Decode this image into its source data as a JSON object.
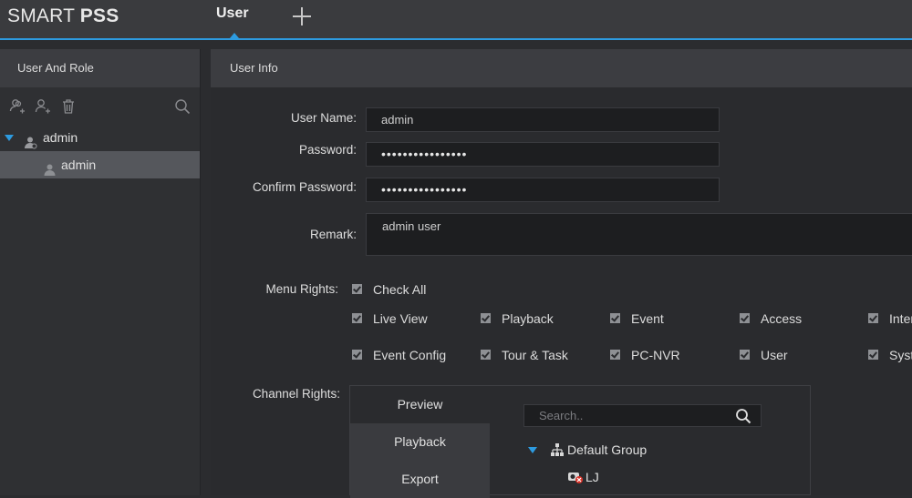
{
  "app": {
    "brand_light": "SMART ",
    "brand_bold": "PSS"
  },
  "tabs": {
    "active": "User"
  },
  "left_panel": {
    "title": "User And Role",
    "tree": [
      {
        "label": "admin",
        "expanded": true
      },
      {
        "label": "admin",
        "selected": true
      }
    ]
  },
  "user_info": {
    "title": "User Info",
    "username_label": "User Name:",
    "username": "admin",
    "password_label": "Password:",
    "password": "••••••••••••••••",
    "confirm_label": "Confirm Password:",
    "confirm": "••••••••••••••••",
    "remark_label": "Remark:",
    "remark": "admin user"
  },
  "menu_rights": {
    "label": "Menu Rights:",
    "check_all": "Check All",
    "items": [
      "Live View",
      "Playback",
      "Event",
      "Access",
      "Inter",
      "Event Config",
      "Tour & Task",
      "PC-NVR",
      "User",
      "Syst"
    ]
  },
  "channel_rights": {
    "label": "Channel Rights:",
    "tabs": [
      "Preview",
      "Playback",
      "Export"
    ],
    "search_placeholder": "Search..",
    "group": "Default Group",
    "device": "LJ"
  },
  "colors": {
    "accent": "#2d9be0",
    "selected_row": "#55575c"
  }
}
